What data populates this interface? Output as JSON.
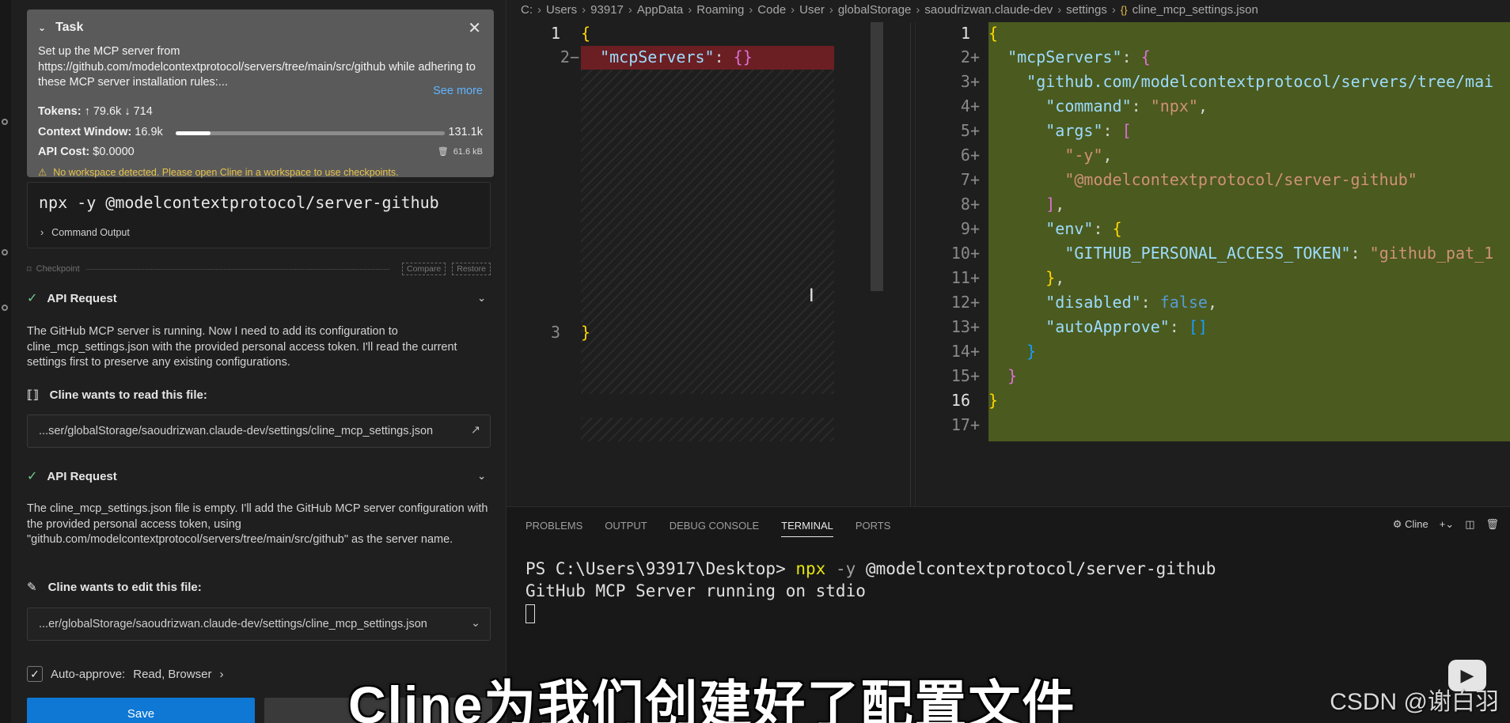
{
  "task": {
    "heading": "Task",
    "text": "Set up the MCP server from https://github.com/modelcontextprotocol/servers/tree/main/src/github while adhering to these MCP server installation rules:...",
    "see_more": "See more",
    "tokens_label": "Tokens:",
    "tokens_up": "↑ 79.6k",
    "tokens_down": "↓ 714",
    "context_label": "Context Window:",
    "context_used": "16.9k",
    "context_max": "131.1k",
    "context_fraction": 0.129,
    "api_cost_label": "API Cost:",
    "api_cost": "$0.0000",
    "size": "61.6 kB",
    "warning": "No workspace detected. Please open Cline in a workspace to use checkpoints."
  },
  "command": {
    "text": "npx -y @modelcontextprotocol/server-github",
    "output_label": "Command Output"
  },
  "checkpoint": {
    "label": "Checkpoint",
    "compare": "Compare",
    "restore": "Restore"
  },
  "requests": [
    {
      "title": "API Request",
      "text": "The GitHub MCP server is running. Now I need to add its configuration to cline_mcp_settings.json with the provided personal access token. I'll read the current settings first to preserve any existing configurations.",
      "wants": "Cline wants to read this file:",
      "file": "...ser/globalStorage/saoudrizwan.claude-dev/settings/cline_mcp_settings.json"
    },
    {
      "title": "API Request",
      "text": "The cline_mcp_settings.json file is empty. I'll add the GitHub MCP server configuration with the provided personal access token, using \"github.com/modelcontextprotocol/servers/tree/main/src/github\" as the server name.",
      "wants": "Cline wants to edit this file:",
      "file": "...er/globalStorage/saoudrizwan.claude-dev/settings/cline_mcp_settings.json"
    }
  ],
  "auto_approve": {
    "label": "Auto-approve:",
    "value": "Read, Browser"
  },
  "save_label": "Save",
  "breadcrumb": [
    "C:",
    "Users",
    "93917",
    "AppData",
    "Roaming",
    "Code",
    "User",
    "globalStorage",
    "saoudrizwan.claude-dev",
    "settings",
    "cline_mcp_settings.json"
  ],
  "diff_left": {
    "line_numbers": [
      "1",
      "2−",
      "3"
    ],
    "lines": [
      "{",
      "  \"mcpServers\": {}",
      "}"
    ]
  },
  "diff_right": {
    "line_numbers": [
      "1",
      "2+",
      "3+",
      "4+",
      "5+",
      "6+",
      "7+",
      "8+",
      "9+",
      "10+",
      "11+",
      "12+",
      "13+",
      "14+",
      "15+",
      "16",
      "17+"
    ],
    "key_mcp": "\"mcpServers\"",
    "key_server": "\"github.com/modelcontextprotocol/servers/tree/mai",
    "key_command": "\"command\"",
    "val_command": "\"npx\"",
    "key_args": "\"args\"",
    "arg1": "\"-y\"",
    "arg2": "\"@modelcontextprotocol/server-github\"",
    "key_env": "\"env\"",
    "key_token": "\"GITHUB_PERSONAL_ACCESS_TOKEN\"",
    "val_token": "\"github_pat_1",
    "key_disabled": "\"disabled\"",
    "val_disabled": "false",
    "key_auto": "\"autoApprove\"",
    "val_auto": "[]"
  },
  "panel": {
    "tabs": [
      "PROBLEMS",
      "OUTPUT",
      "DEBUG CONSOLE",
      "TERMINAL",
      "PORTS"
    ],
    "active_tab": "TERMINAL",
    "terminal_name": "Cline",
    "prompt": "PS C:\\Users\\93917\\Desktop>",
    "cmd_npx": "npx",
    "cmd_flag": "-y",
    "cmd_pkg": "@modelcontextprotocol/server-github",
    "output_line": "GitHub MCP Server running on stdio"
  },
  "overlay": {
    "subtitle": "Cline为我们创建好了配置文件",
    "watermark": "CSDN @谢白羽"
  },
  "colors": {
    "accent": "#0e78d4",
    "removed_bg": "#6b1f23",
    "added_bg": "#4b5a1e",
    "warning": "#e7c34a",
    "link": "#5fb3ff"
  },
  "icons": {
    "close": "close-icon",
    "check": "check-icon",
    "chevron": "chevron-down-icon",
    "warning": "warning-icon",
    "trash": "trash-icon",
    "file": "file-code-icon",
    "pencil": "pencil-icon",
    "external": "link-external-icon"
  }
}
